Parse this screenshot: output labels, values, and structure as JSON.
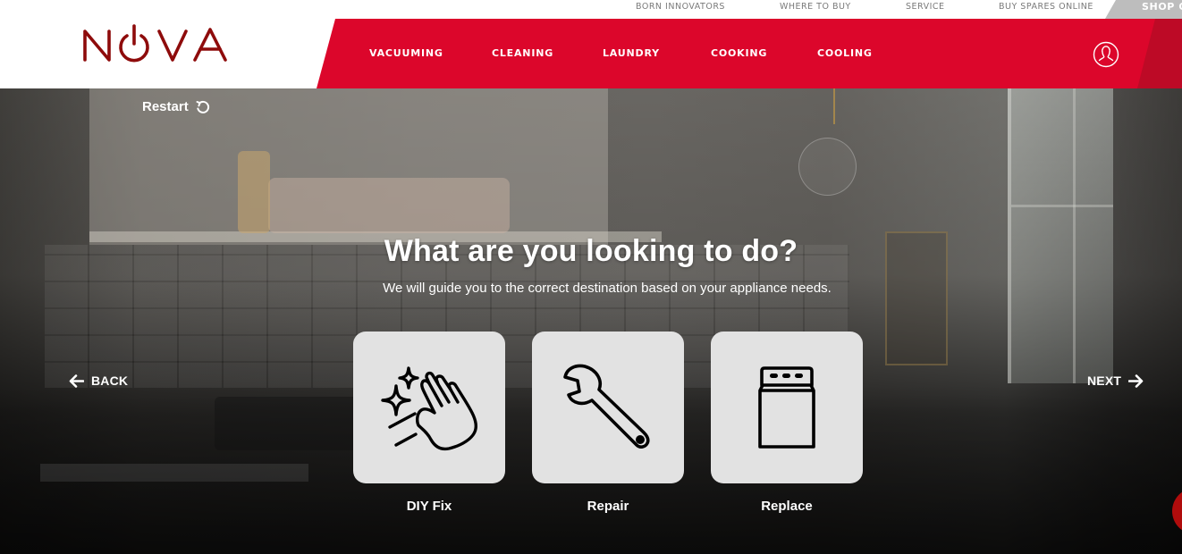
{
  "utility_nav": {
    "links": [
      {
        "label": "BORN INNOVATORS"
      },
      {
        "label": "WHERE TO BUY"
      },
      {
        "label": "SERVICE"
      },
      {
        "label": "BUY SPARES ONLINE"
      }
    ],
    "shop_label": "SHOP ONLINE"
  },
  "header": {
    "logo_text": "NOVA",
    "nav": [
      {
        "label": "VACUUMING"
      },
      {
        "label": "CLEANING"
      },
      {
        "label": "LAUNDRY"
      },
      {
        "label": "COOKING"
      },
      {
        "label": "COOLING"
      }
    ],
    "account_icon": "user-circle-icon"
  },
  "colors": {
    "brand_red": "#dc062b",
    "brand_red_dark": "#bd0a26",
    "logo_red": "#8e0b0b",
    "card_bg": "#e2e2e2",
    "utility_text": "#7a7a7a",
    "shop_bg": "#bdbdbd"
  },
  "wizard": {
    "restart_label": "Restart",
    "restart_icon": "restart-icon",
    "title": "What are you looking to do?",
    "subtitle": "We will guide you to the correct destination based on your appliance needs.",
    "back_label": "BACK",
    "next_label": "NEXT",
    "options": [
      {
        "label": "DIY Fix",
        "icon": "sparkle-hand-icon"
      },
      {
        "label": "Repair",
        "icon": "wrench-icon"
      },
      {
        "label": "Replace",
        "icon": "appliance-icon"
      }
    ]
  }
}
